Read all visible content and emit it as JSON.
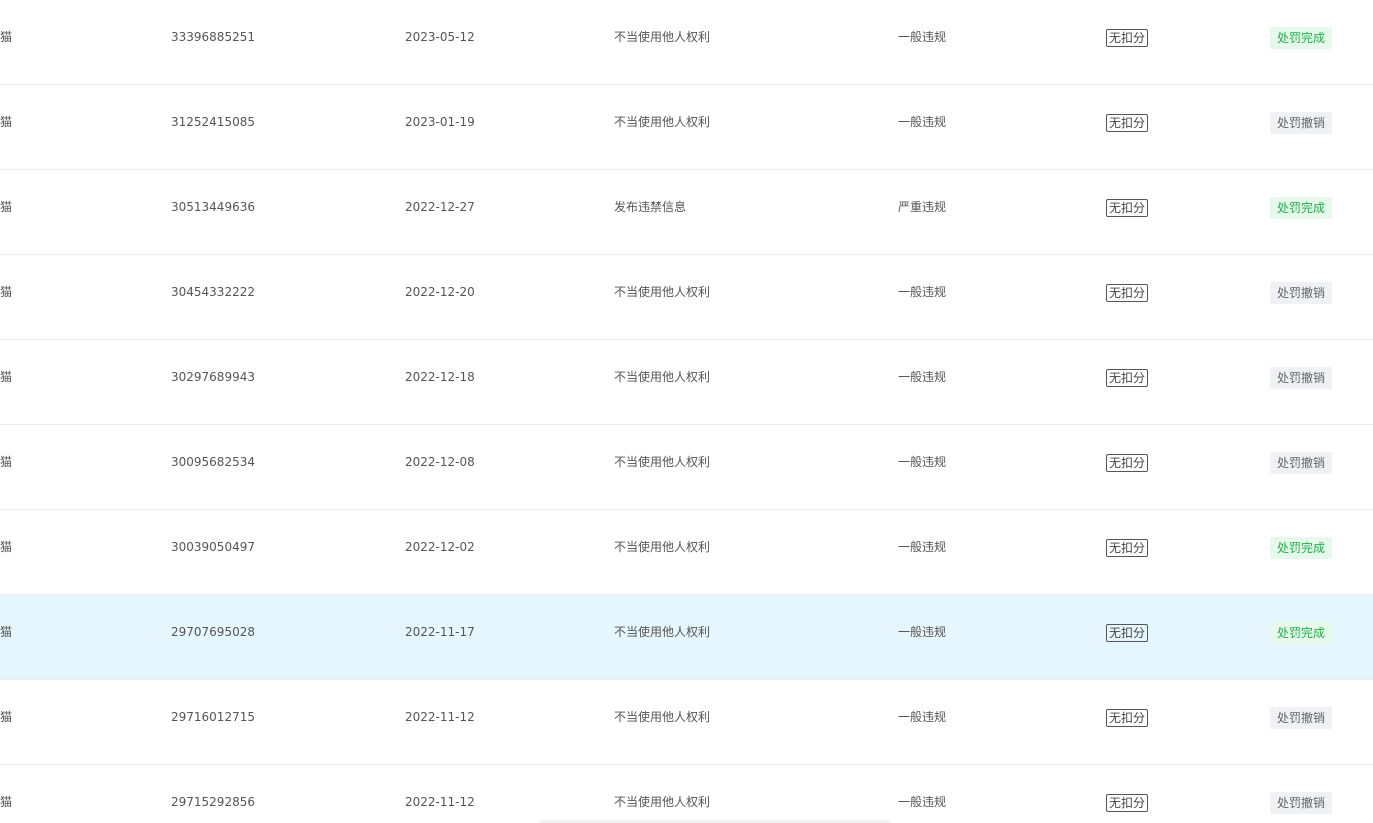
{
  "colors": {
    "highlight_row": "#e6f6fe",
    "done_bg": "#e7f9ea",
    "done_text": "#21b14a",
    "cancel_bg": "#f0f1f4",
    "cancel_text": "#666666"
  },
  "rows": [
    {
      "shop": "天猫",
      "id": "33396885251",
      "date": "2023-05-12",
      "reason": "不当使用他人权利",
      "level": "一般违规",
      "score": "无扣分",
      "status": "处罚完成",
      "status_type": "done"
    },
    {
      "shop": "天猫",
      "id": "31252415085",
      "date": "2023-01-19",
      "reason": "不当使用他人权利",
      "level": "一般违规",
      "score": "无扣分",
      "status": "处罚撤销",
      "status_type": "cancel"
    },
    {
      "shop": "天猫",
      "id": "30513449636",
      "date": "2022-12-27",
      "reason": "发布违禁信息",
      "level": "严重违规",
      "score": "无扣分",
      "status": "处罚完成",
      "status_type": "done"
    },
    {
      "shop": "天猫",
      "id": "30454332222",
      "date": "2022-12-20",
      "reason": "不当使用他人权利",
      "level": "一般违规",
      "score": "无扣分",
      "status": "处罚撤销",
      "status_type": "cancel"
    },
    {
      "shop": "天猫",
      "id": "30297689943",
      "date": "2022-12-18",
      "reason": "不当使用他人权利",
      "level": "一般违规",
      "score": "无扣分",
      "status": "处罚撤销",
      "status_type": "cancel"
    },
    {
      "shop": "天猫",
      "id": "30095682534",
      "date": "2022-12-08",
      "reason": "不当使用他人权利",
      "level": "一般违规",
      "score": "无扣分",
      "status": "处罚撤销",
      "status_type": "cancel"
    },
    {
      "shop": "天猫",
      "id": "30039050497",
      "date": "2022-12-02",
      "reason": "不当使用他人权利",
      "level": "一般违规",
      "score": "无扣分",
      "status": "处罚完成",
      "status_type": "done"
    },
    {
      "shop": "天猫",
      "id": "29707695028",
      "date": "2022-11-17",
      "reason": "不当使用他人权利",
      "level": "一般违规",
      "score": "无扣分",
      "status": "处罚完成",
      "status_type": "done",
      "highlighted": true
    },
    {
      "shop": "天猫",
      "id": "29716012715",
      "date": "2022-11-12",
      "reason": "不当使用他人权利",
      "level": "一般违规",
      "score": "无扣分",
      "status": "处罚撤销",
      "status_type": "cancel"
    },
    {
      "shop": "天猫",
      "id": "29715292856",
      "date": "2022-11-12",
      "reason": "不当使用他人权利",
      "level": "一般违规",
      "score": "无扣分",
      "status": "处罚撤销",
      "status_type": "cancel"
    }
  ]
}
